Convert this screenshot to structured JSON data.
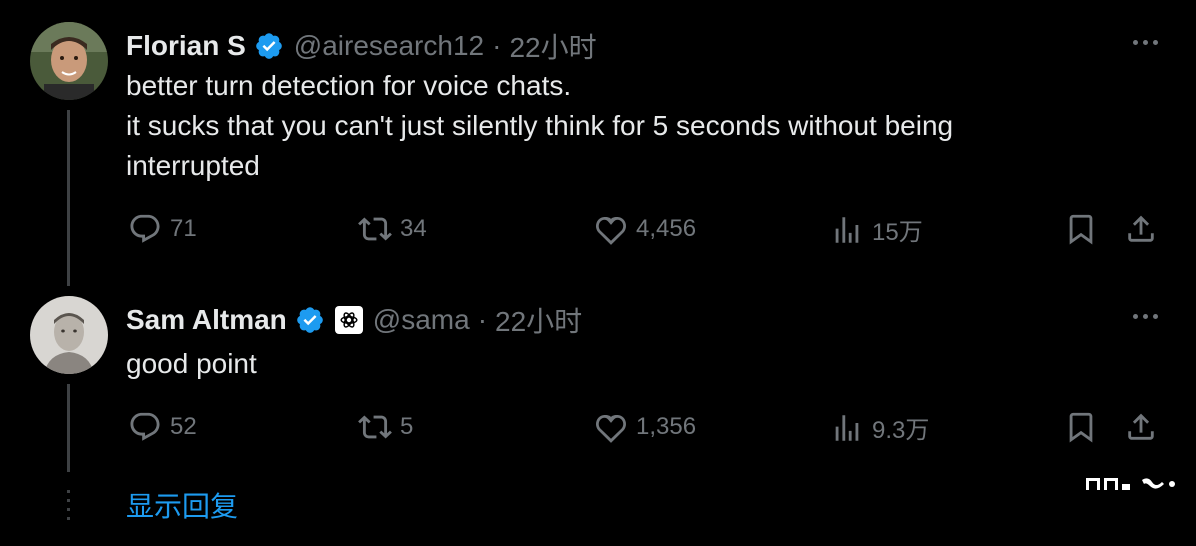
{
  "tweets": [
    {
      "name": "Florian S",
      "handle": "@airesearch12",
      "separator": "·",
      "time": "22小时",
      "text": "better turn detection for voice chats.\nit sucks that you can't just silently think for 5 seconds without being\ninterrupted",
      "replies": "71",
      "retweets": "34",
      "likes": "4,456",
      "views": "15万"
    },
    {
      "name": "Sam Altman",
      "handle": "@sama",
      "separator": "·",
      "time": "22小时",
      "text": "good point",
      "replies": "52",
      "retweets": "5",
      "likes": "1,356",
      "views": "9.3万"
    }
  ],
  "show_replies": "显示回复",
  "colors": {
    "background": "#000000",
    "text": "#e7e9ea",
    "muted": "#71767b",
    "accent": "#1d9bf0",
    "thread_line": "#3e4144"
  },
  "icons": [
    "verified-badge-icon",
    "openai-affiliate-icon",
    "more-icon",
    "reply-icon",
    "retweet-icon",
    "like-icon",
    "views-icon",
    "bookmark-icon",
    "share-icon"
  ]
}
